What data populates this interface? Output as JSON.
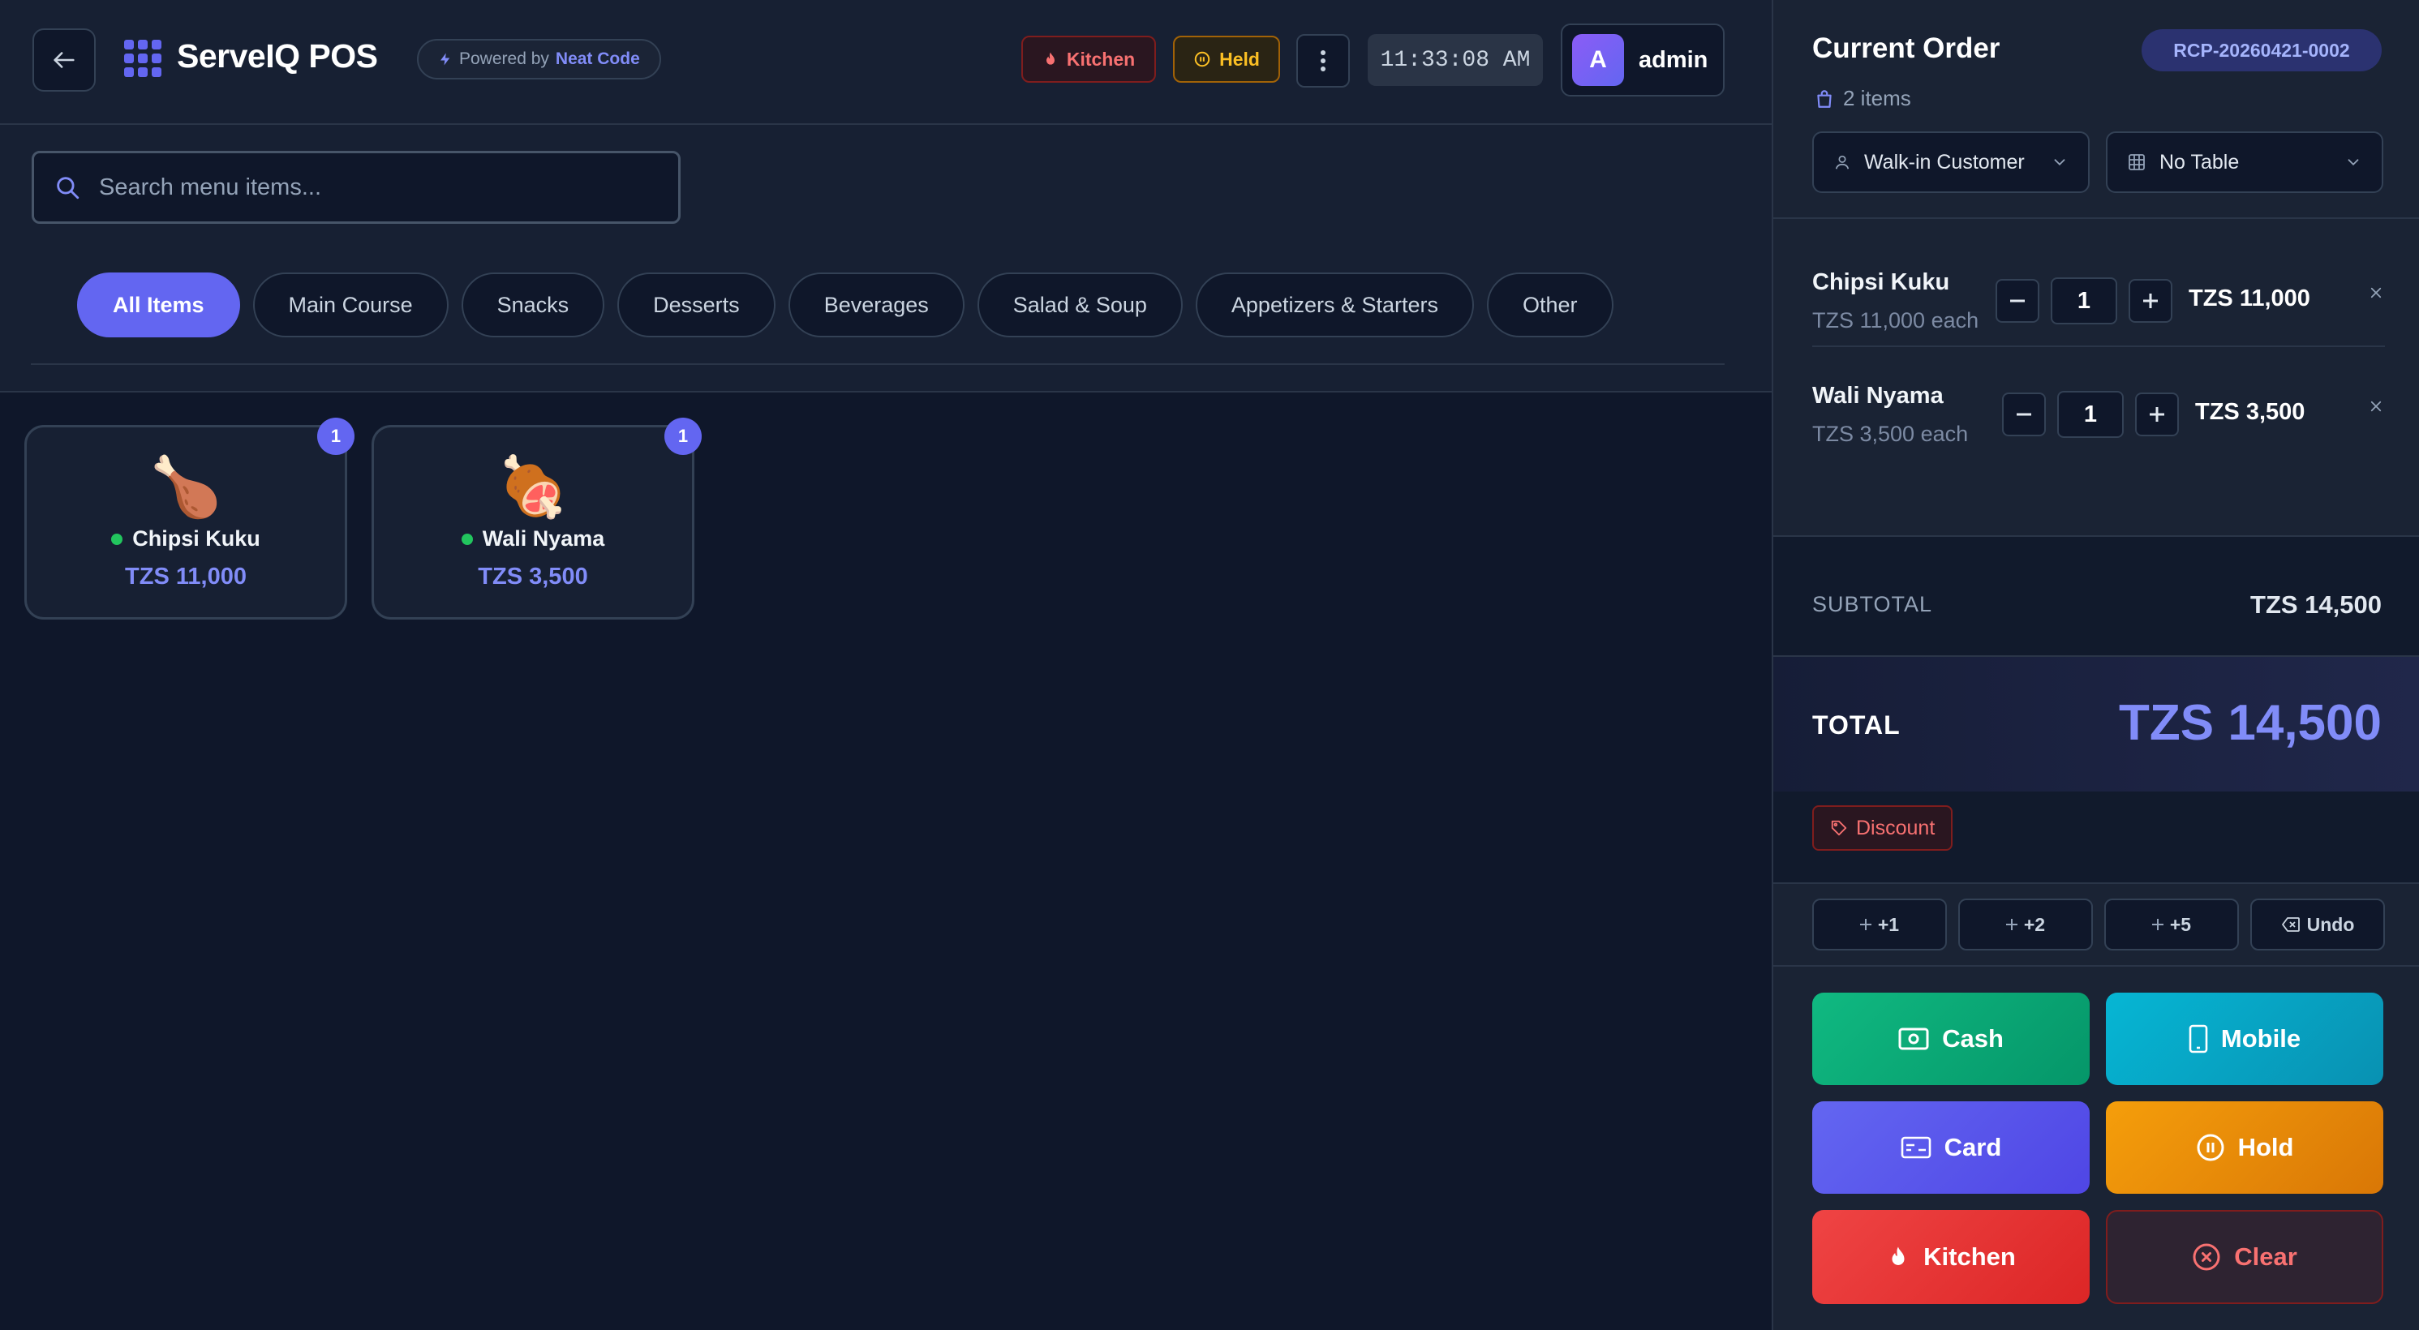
{
  "header": {
    "app_title": "ServeIQ POS",
    "powered_by": "Powered by",
    "powered_brand": "Neat Code",
    "kitchen_label": "Kitchen",
    "held_label": "Held",
    "clock": "11:33:08 AM",
    "user_initial": "A",
    "user_name": "admin"
  },
  "search": {
    "placeholder": "Search menu items...",
    "value": ""
  },
  "categories": [
    {
      "label": "All Items",
      "active": true
    },
    {
      "label": "Main Course",
      "active": false
    },
    {
      "label": "Snacks",
      "active": false
    },
    {
      "label": "Desserts",
      "active": false
    },
    {
      "label": "Beverages",
      "active": false
    },
    {
      "label": "Salad & Soup",
      "active": false
    },
    {
      "label": "Appetizers & Starters",
      "active": false
    },
    {
      "label": "Other",
      "active": false
    }
  ],
  "menu_items": [
    {
      "emoji": "🍗",
      "name": "Chipsi Kuku",
      "price": "TZS 11,000",
      "in_cart": "1",
      "available": true
    },
    {
      "emoji": "🍖",
      "name": "Wali Nyama",
      "price": "TZS 3,500",
      "in_cart": "1",
      "available": true
    }
  ],
  "order": {
    "title": "Current Order",
    "receipt": "RCP-20260421-0002",
    "item_count": "2 items",
    "customer": "Walk-in Customer",
    "table": "No Table",
    "lines": [
      {
        "name": "Chipsi Kuku",
        "each": "TZS 11,000 each",
        "qty": "1",
        "total": "TZS 11,000"
      },
      {
        "name": "Wali Nyama",
        "each": "TZS 3,500 each",
        "qty": "1",
        "total": "TZS 3,500"
      }
    ],
    "subtotal_label": "SUBTOTAL",
    "subtotal": "TZS 14,500",
    "total_label": "TOTAL",
    "total": "TZS 14,500",
    "discount_label": "Discount",
    "quick_adds": [
      "+1",
      "+2",
      "+5"
    ],
    "undo_label": "Undo",
    "actions": {
      "cash": "Cash",
      "mobile": "Mobile",
      "card": "Card",
      "hold": "Hold",
      "kitchen": "Kitchen",
      "clear": "Clear"
    }
  },
  "colors": {
    "background": "#0f172a",
    "panel": "#1a2334",
    "accent": "#6366f1",
    "price": "#818cf8",
    "cash": "#10b981",
    "mobile": "#06b6d4",
    "hold": "#f59e0b",
    "danger": "#ef4444",
    "available": "#22c55e"
  },
  "icons": {
    "back": "arrow-left-icon",
    "logo": "grid-icon",
    "powered": "bolt-icon",
    "kitchen": "flame-icon",
    "held": "pause-circle-icon",
    "more": "dots-vertical-icon",
    "search": "search-icon",
    "items": "bag-icon",
    "customer": "user-icon",
    "table": "table-grid-icon",
    "remove": "close-icon",
    "discount": "tag-icon",
    "cash": "banknote-icon",
    "mobile": "phone-icon",
    "card": "credit-card-icon",
    "clear": "x-circle-icon"
  }
}
